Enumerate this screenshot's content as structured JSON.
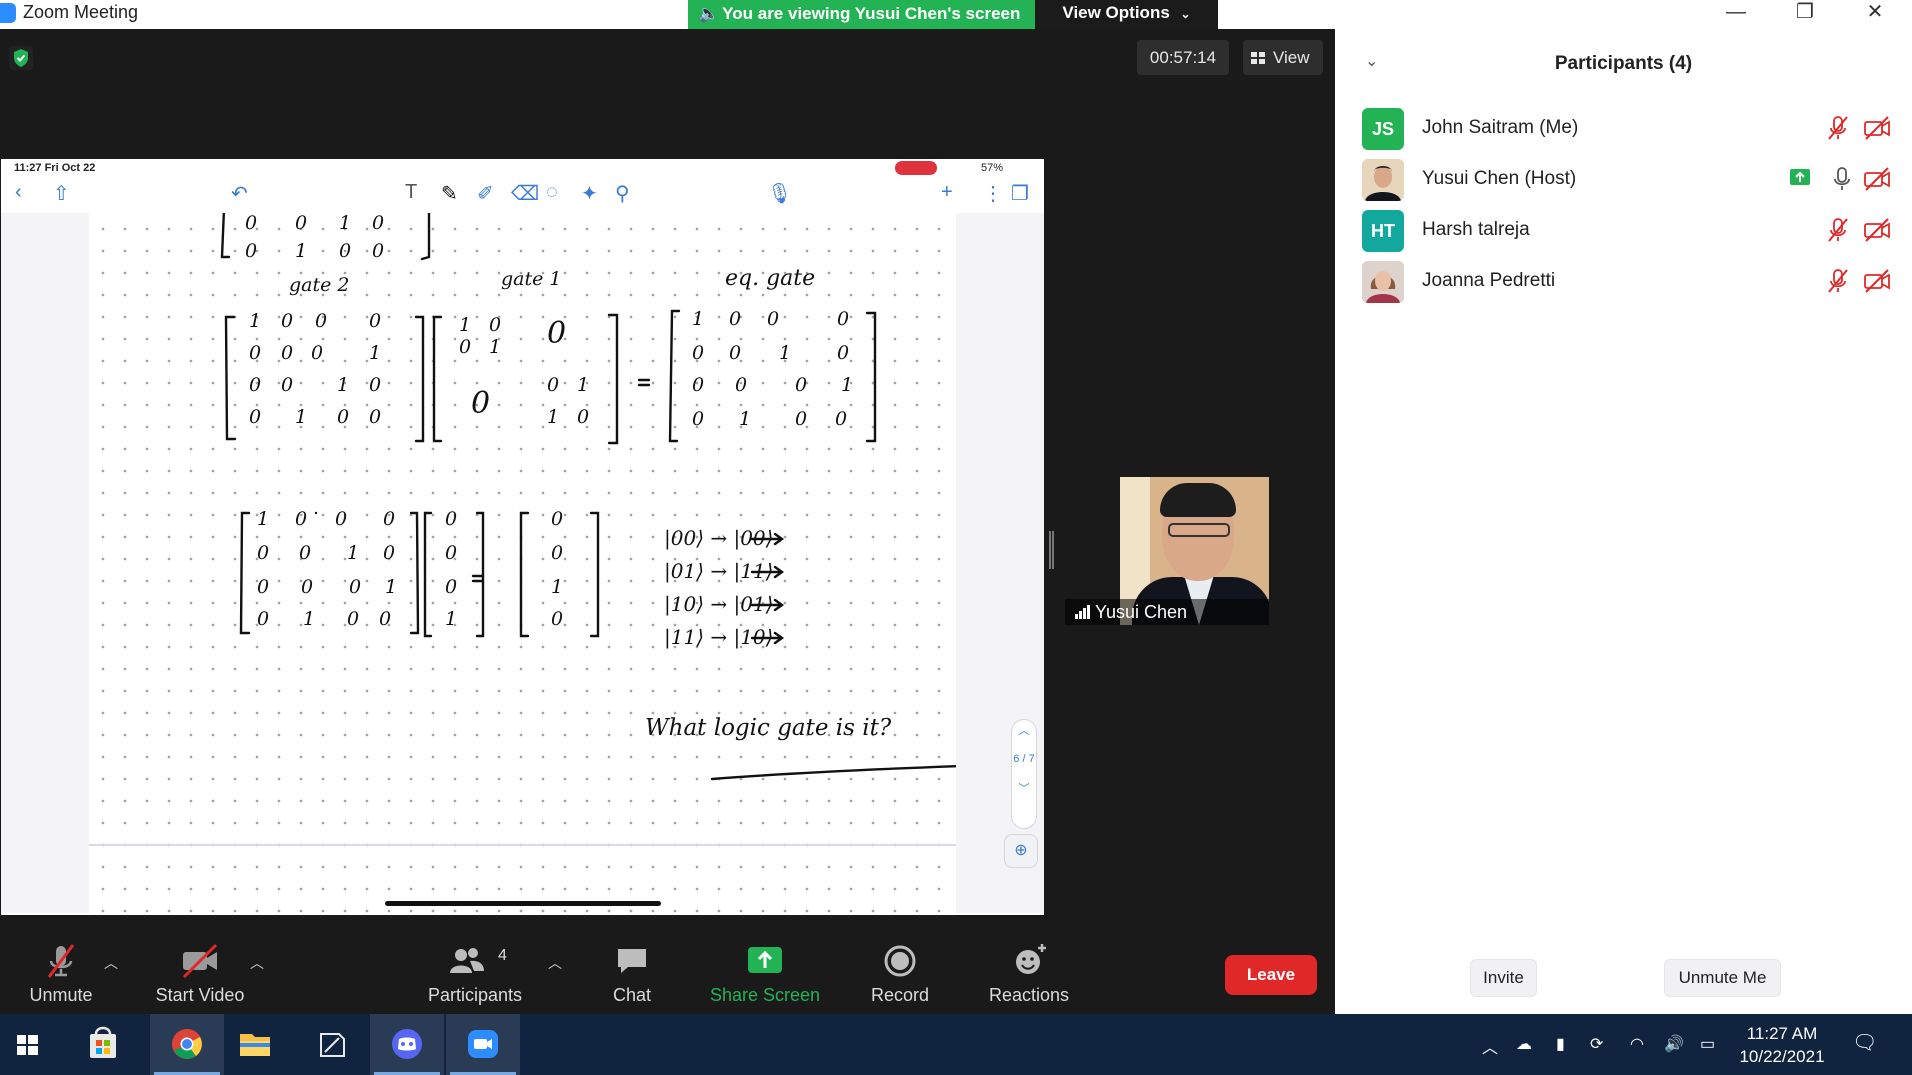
{
  "titlebar": {
    "app_title": "Zoom Meeting",
    "banner": "You are viewing Yusui Chen's screen",
    "view_options": "View Options",
    "minimize": "—",
    "restore": "❐",
    "close": "✕"
  },
  "meeting": {
    "timer": "00:57:14",
    "view_label": "View",
    "shared": {
      "status_time": "11:27  Fri Oct 22",
      "battery": "57%",
      "scroll_pages": "6 / 7",
      "notes": {
        "labels": [
          "gate 2",
          "gate 1",
          "eq. gate"
        ],
        "mappings": [
          "|00⟩ → |00⟩",
          "|01⟩ → |11⟩",
          "|10⟩ → |01⟩",
          "|11⟩ → |10⟩"
        ],
        "question": "What logic gate is it?"
      }
    },
    "speaker": {
      "name": "Yusui Chen"
    }
  },
  "toolbar": {
    "unmute": "Unmute",
    "start_video": "Start Video",
    "participants": "Participants",
    "participants_count": "4",
    "chat": "Chat",
    "share_screen": "Share Screen",
    "record": "Record",
    "reactions": "Reactions",
    "leave": "Leave"
  },
  "panel": {
    "title": "Participants (4)",
    "participants": [
      {
        "initials": "JS",
        "name": "John Saitram (Me)",
        "avatar_color": "#23b355",
        "muted": true,
        "video_off": true,
        "sharing": false
      },
      {
        "initials": "",
        "name": "Yusui Chen (Host)",
        "avatar_color": "#c9a27a",
        "muted": false,
        "video_off": true,
        "sharing": true
      },
      {
        "initials": "HT",
        "name": "Harsh talreja",
        "avatar_color": "#13a89e",
        "muted": true,
        "video_off": true,
        "sharing": false
      },
      {
        "initials": "",
        "name": "Joanna Pedretti",
        "avatar_color": "#b78f8f",
        "muted": true,
        "video_off": true,
        "sharing": false
      }
    ],
    "invite": "Invite",
    "unmute_me": "Unmute Me"
  },
  "taskbar": {
    "time": "11:27 AM",
    "date": "10/22/2021"
  },
  "colors": {
    "accent_green": "#23b355",
    "leave_red": "#e02828",
    "muted_red": "#e02828",
    "zoom_blue": "#2d8cff",
    "taskbar": "#10233f"
  }
}
